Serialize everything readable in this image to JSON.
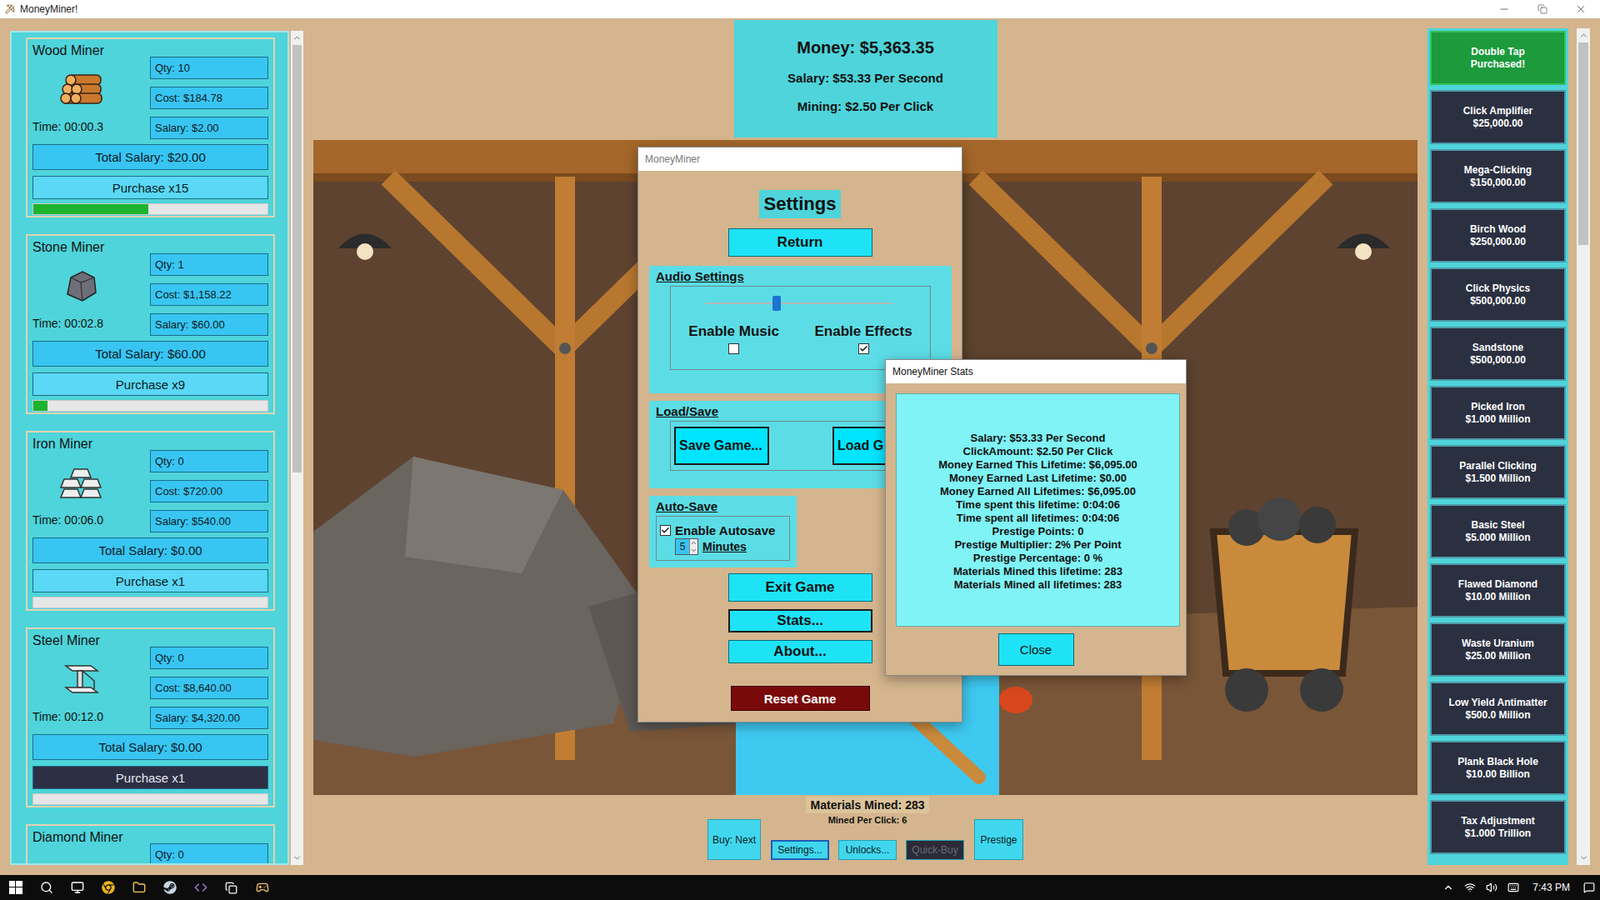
{
  "window": {
    "title": "MoneyMiner!"
  },
  "miners": [
    {
      "name": "Wood Miner",
      "qty": "Qty: 10",
      "cost": "Cost: $184.78",
      "time": "Time: 00:00.3",
      "salary": "Salary: $2.00",
      "total": "Total Salary: $20.00",
      "purchase": "Purchase x15",
      "purchase_disabled": false,
      "level": 0.49
    },
    {
      "name": "Stone Miner",
      "qty": "Qty: 1",
      "cost": "Cost: $1,158.22",
      "time": "Time: 00:02.8",
      "salary": "Salary: $60.00",
      "total": "Total Salary: $60.00",
      "purchase": "Purchase x9",
      "purchase_disabled": false,
      "level": 0.06
    },
    {
      "name": "Iron Miner",
      "qty": "Qty: 0",
      "cost": "Cost: $720.00",
      "time": "Time: 00:06.0",
      "salary": "Salary: $540.00",
      "total": "Total Salary: $0.00",
      "purchase": "Purchase x1",
      "purchase_disabled": false,
      "level": 0
    },
    {
      "name": "Steel Miner",
      "qty": "Qty: 0",
      "cost": "Cost: $8,640.00",
      "time": "Time: 00:12.0",
      "salary": "Salary: $4,320.00",
      "total": "Total Salary: $0.00",
      "purchase": "Purchase x1",
      "purchase_disabled": true,
      "level": 0
    },
    {
      "name": "Diamond Miner",
      "qty": "Qty: 0"
    }
  ],
  "miner_list_scroll": {
    "position": 0,
    "size": 0.53
  },
  "status": {
    "money": "Money: $5,363.35",
    "salary": "Salary: $53.33 Per Second",
    "mining": "Mining: $2.50 Per Click"
  },
  "upgrades": [
    {
      "name": "Double Tap",
      "price": "Purchased!",
      "purchased": true
    },
    {
      "name": "Click Amplifier",
      "price": "$25,000.00",
      "purchased": false
    },
    {
      "name": "Mega-Clicking",
      "price": "$150,000.00",
      "purchased": false
    },
    {
      "name": "Birch Wood",
      "price": "$250,000.00",
      "purchased": false
    },
    {
      "name": "Click Physics",
      "price": "$500,000.00",
      "purchased": false
    },
    {
      "name": "Sandstone",
      "price": "$500,000.00",
      "purchased": false
    },
    {
      "name": "Picked Iron",
      "price": "$1.000 Million",
      "purchased": false
    },
    {
      "name": "Parallel Clicking",
      "price": "$1.500 Million",
      "purchased": false
    },
    {
      "name": "Basic Steel",
      "price": "$5.000 Million",
      "purchased": false
    },
    {
      "name": "Flawed Diamond",
      "price": "$10.00 Million",
      "purchased": false
    },
    {
      "name": "Waste Uranium",
      "price": "$25.00 Million",
      "purchased": false
    },
    {
      "name": "Low Yield Antimatter",
      "price": "$500.0 Million",
      "purchased": false
    },
    {
      "name": "Plank Black Hole",
      "price": "$10.00 Billion",
      "purchased": false
    },
    {
      "name": "Tax Adjustment",
      "price": "$1.000 Trillion",
      "purchased": false
    }
  ],
  "upgrade_list_scroll": {
    "position": 0,
    "size": 0.25
  },
  "footer": {
    "materials": "Materials Mined: 283",
    "per_click": "Mined Per Click: 6",
    "controls": [
      {
        "label": "Buy: Next",
        "kind": "tall",
        "selected": false,
        "disabled": false
      },
      {
        "label": "Settings...",
        "kind": "small",
        "selected": true,
        "disabled": false
      },
      {
        "label": "Unlocks...",
        "kind": "small",
        "selected": false,
        "disabled": false
      },
      {
        "label": "Quick-Buy",
        "kind": "small",
        "selected": false,
        "disabled": true
      },
      {
        "label": "Prestige",
        "kind": "tall",
        "selected": false,
        "disabled": false
      }
    ]
  },
  "settings_dialog": {
    "title": "MoneyMiner",
    "heading": "Settings",
    "return_button": "Return",
    "audio": {
      "label": "Audio Settings",
      "volume": {
        "level": 0.38
      },
      "options": [
        {
          "label": "Enable Music",
          "checked": false
        },
        {
          "label": "Enable Effects",
          "checked": true
        }
      ]
    },
    "load_save": {
      "label": "Load/Save",
      "buttons": [
        "Save Game...",
        "Load G"
      ]
    },
    "autosave": {
      "label": "Auto-Save",
      "option": {
        "label": "Enable Autosave",
        "checked": true
      },
      "interval": "5",
      "unit": "Minutes"
    },
    "buttons": [
      {
        "label": "Exit Game",
        "kind": "normal",
        "focused": false
      },
      {
        "label": "Stats...",
        "kind": "normal",
        "focused": true
      },
      {
        "label": "About...",
        "kind": "normal",
        "focused": false
      },
      {
        "label": "Reset Game",
        "kind": "danger",
        "focused": false
      }
    ]
  },
  "stats_dialog": {
    "title": "MoneyMiner Stats",
    "lines": [
      "Salary: $53.33 Per Second",
      "ClickAmount: $2.50 Per Click",
      "Money Earned This Lifetime: $6,095.00",
      "Money Earned Last Lifetime: $0.00",
      "Money Earned All Lifetimes: $6,095.00",
      "Time spent this lifetime: 0:04:06",
      "Time spent all lifetimes: 0:04:06",
      "Prestige Points: 0",
      "Prestige Multiplier: 2% Per Point",
      "Prestige Percentage: 0 %",
      "Materials Mined this lifetime: 283",
      "Materials Mined all lifetimes: 283"
    ],
    "close": "Close"
  },
  "taskbar": {
    "time": "7:43 PM"
  }
}
